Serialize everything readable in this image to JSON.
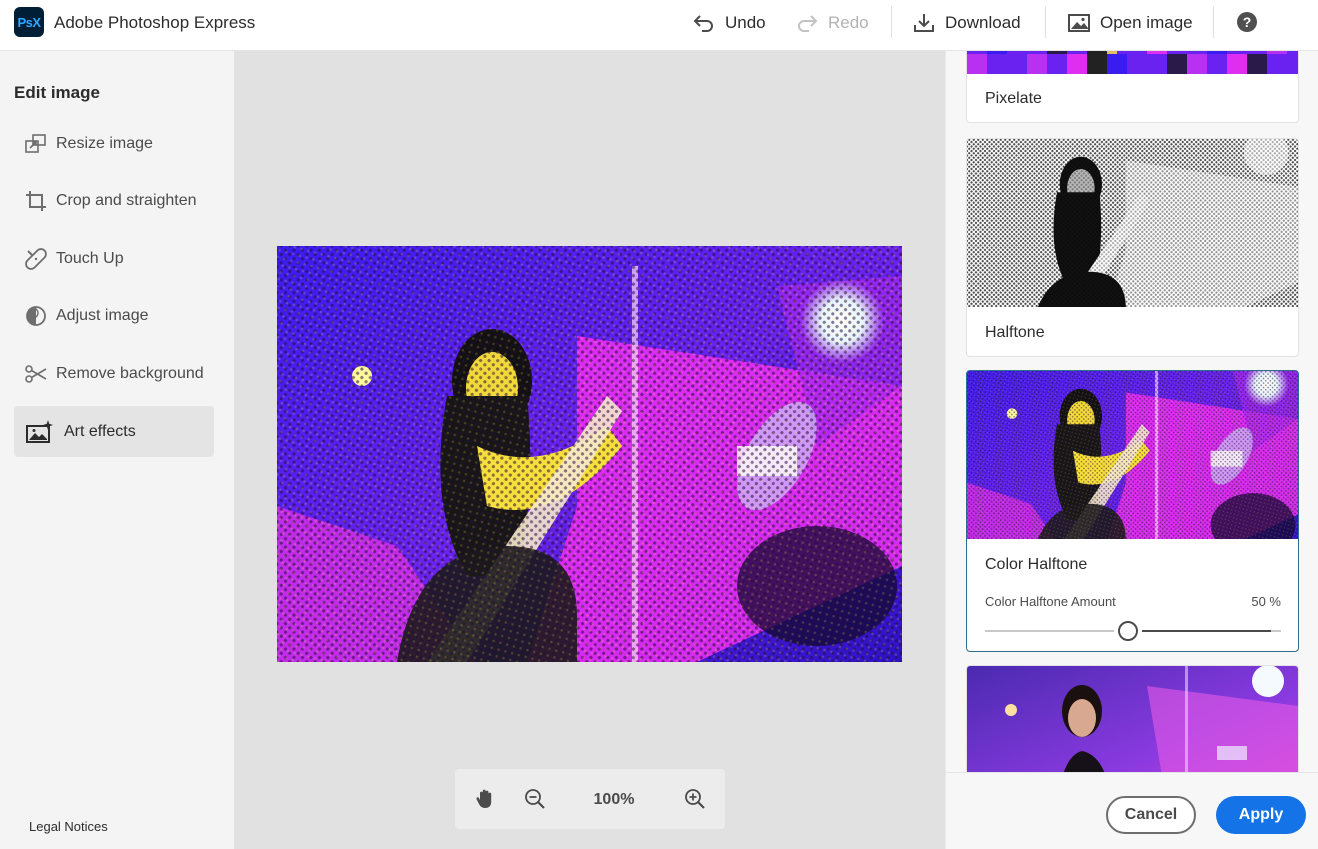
{
  "header": {
    "logo_text": "PsX",
    "app_title": "Adobe Photoshop Express",
    "actions": [
      {
        "label": "Undo",
        "icon": "undo-icon",
        "enabled": true
      },
      {
        "label": "Redo",
        "icon": "redo-icon",
        "enabled": false
      },
      {
        "label": "Download",
        "icon": "download-icon",
        "enabled": true
      },
      {
        "label": "Open image",
        "icon": "image-icon",
        "enabled": true
      }
    ],
    "help_label": "?"
  },
  "sidebar": {
    "heading": "Edit image",
    "items": [
      {
        "label": "Resize image",
        "icon": "resize-icon"
      },
      {
        "label": "Crop and straighten",
        "icon": "crop-icon"
      },
      {
        "label": "Touch Up",
        "icon": "bandage-icon"
      },
      {
        "label": "Adjust image",
        "icon": "adjust-icon"
      },
      {
        "label": "Remove background",
        "icon": "scissors-icon"
      },
      {
        "label": "Art effects",
        "icon": "sparkle-image-icon",
        "active": true
      }
    ],
    "legal": "Legal Notices"
  },
  "zoom": {
    "level": "100%",
    "tools": [
      "hand-icon",
      "zoom-out-icon",
      "zoom-in-icon"
    ]
  },
  "effects": {
    "cards": [
      {
        "label": "Pixelate"
      },
      {
        "label": "Halftone"
      },
      {
        "label": "Color Halftone",
        "selected": true,
        "slider_label": "Color Halftone Amount",
        "slider_value": "50 %",
        "slider_fraction": 0.5
      },
      {
        "label": ""
      }
    ]
  },
  "footer": {
    "cancel": "Cancel",
    "apply": "Apply"
  },
  "colors": {
    "accent": "#1473e6",
    "selected_border": "#2b6f8f",
    "logo_bg": "#001e36",
    "logo_fg": "#31a8ff"
  }
}
